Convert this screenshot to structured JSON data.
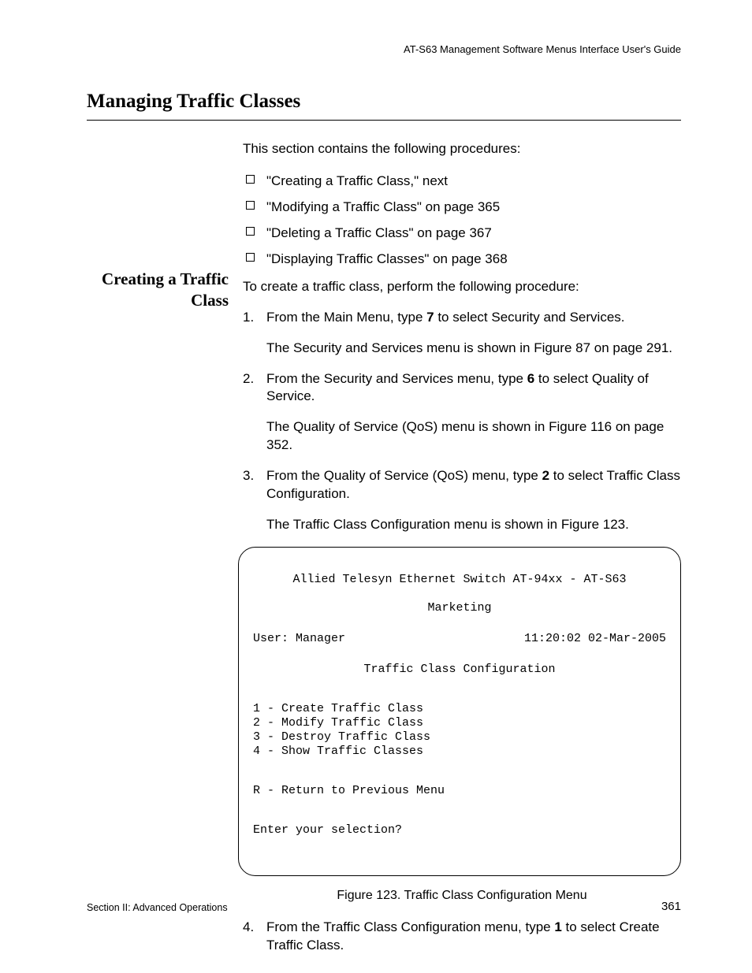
{
  "header": {
    "running": "AT-S63 Management Software Menus Interface User's Guide"
  },
  "title": "Managing Traffic Classes",
  "intro": "This section contains the following procedures:",
  "bullets": [
    "\"Creating a Traffic Class,\"  next",
    "\"Modifying a Traffic Class\" on page 365",
    "\"Deleting a Traffic Class\" on page 367",
    "\"Displaying Traffic Classes\" on page 368"
  ],
  "side_heading": "Creating a Traffic Class",
  "procedure_intro": "To create a traffic class, perform the following procedure:",
  "steps": {
    "s1": {
      "num": "1.",
      "pre": "From the Main Menu, type ",
      "key": "7",
      "post": " to select Security and Services.",
      "result": "The Security and Services menu is shown in Figure 87 on page 291."
    },
    "s2": {
      "num": "2.",
      "pre": "From the Security and Services menu, type ",
      "key": "6",
      "post": " to select Quality of Service.",
      "result": "The Quality of Service (QoS) menu is shown in Figure 116 on page 352."
    },
    "s3": {
      "num": "3.",
      "pre": "From the Quality of Service (QoS) menu, type ",
      "key": "2",
      "post": " to select Traffic Class Configuration.",
      "result": "The Traffic Class Configuration menu is shown in Figure 123."
    },
    "s4": {
      "num": "4.",
      "pre": "From the Traffic Class Configuration menu, type ",
      "key": "1",
      "post": " to select Create Traffic Class."
    }
  },
  "terminal": {
    "line1": "Allied Telesyn Ethernet Switch AT-94xx - AT-S63",
    "line2": "Marketing",
    "user": "User: Manager",
    "time": "11:20:02 02-Mar-2005",
    "menu_title": "Traffic Class Configuration",
    "opt1": "1 - Create Traffic Class",
    "opt2": "2 - Modify Traffic Class",
    "opt3": "3 - Destroy Traffic Class",
    "opt4": "4 - Show Traffic Classes",
    "optR": "R - Return to Previous Menu",
    "prompt": "Enter your selection?"
  },
  "figure_caption": "Figure 123. Traffic Class Configuration Menu",
  "footer": {
    "left": "Section II: Advanced Operations",
    "right": "361"
  }
}
